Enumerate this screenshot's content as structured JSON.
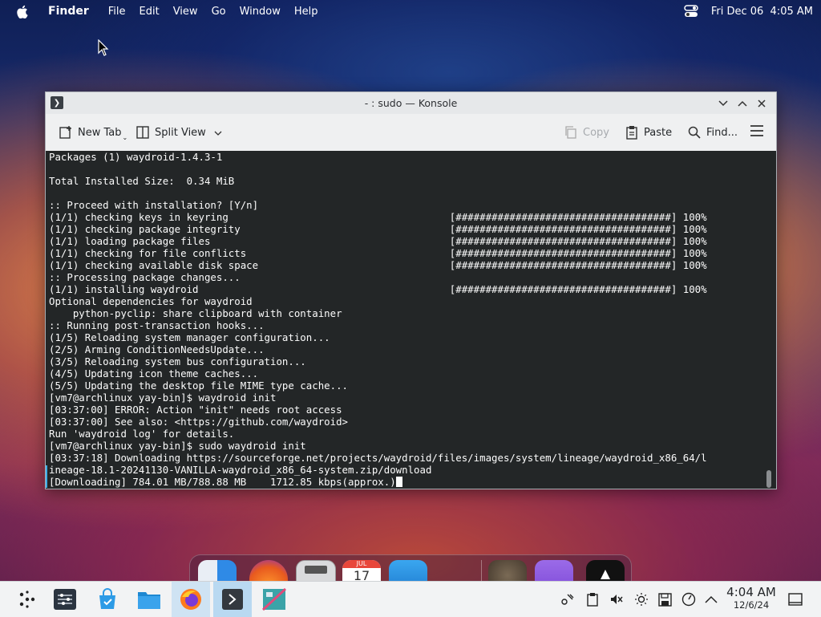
{
  "menubar": {
    "app_name": "Finder",
    "menus": [
      "File",
      "Edit",
      "View",
      "Go",
      "Window",
      "Help"
    ],
    "datetime": "Fri Dec 06  4:05 AM",
    "icons": [
      "apple-logo-icon",
      "control-center-icon"
    ]
  },
  "window": {
    "title": "- : sudo — Konsole",
    "toolbar": {
      "new_tab": "New Tab",
      "split_view": "Split View",
      "copy": "Copy",
      "paste": "Paste",
      "find": "Find..."
    }
  },
  "terminal": {
    "lines": [
      "Packages (1) waydroid-1.4.3-1",
      "",
      "Total Installed Size:  0.34 MiB",
      "",
      ":: Proceed with installation? [Y/n]",
      "(1/1) checking keys in keyring                                     [####################################] 100%",
      "(1/1) checking package integrity                                   [####################################] 100%",
      "(1/1) loading package files                                        [####################################] 100%",
      "(1/1) checking for file conflicts                                  [####################################] 100%",
      "(1/1) checking available disk space                                [####################################] 100%",
      ":: Processing package changes...",
      "(1/1) installing waydroid                                          [####################################] 100%",
      "Optional dependencies for waydroid",
      "    python-pyclip: share clipboard with container",
      ":: Running post-transaction hooks...",
      "(1/5) Reloading system manager configuration...",
      "(2/5) Arming ConditionNeedsUpdate...",
      "(3/5) Reloading system bus configuration...",
      "(4/5) Updating icon theme caches...",
      "(5/5) Updating the desktop file MIME type cache...",
      "[vm7@archlinux yay-bin]$ waydroid init",
      "[03:37:00] ERROR: Action \"init\" needs root access",
      "[03:37:00] See also: <https://github.com/waydroid>",
      "Run 'waydroid log' for details.",
      "[vm7@archlinux yay-bin]$ sudo waydroid init",
      "[03:37:18] Downloading https://sourceforge.net/projects/waydroid/files/images/system/lineage/waydroid_x86_64/l",
      "ineage-18.1-20241130-VANILLA-waydroid_x86_64-system.zip/download",
      "[Downloading] 784.01 MB/788.88 MB    1712.85 kbps(approx.)"
    ]
  },
  "dock": {
    "calendar_month": "JUL",
    "calendar_day": "17"
  },
  "taskbar": {
    "time": "4:04 AM",
    "date": "12/6/24"
  }
}
